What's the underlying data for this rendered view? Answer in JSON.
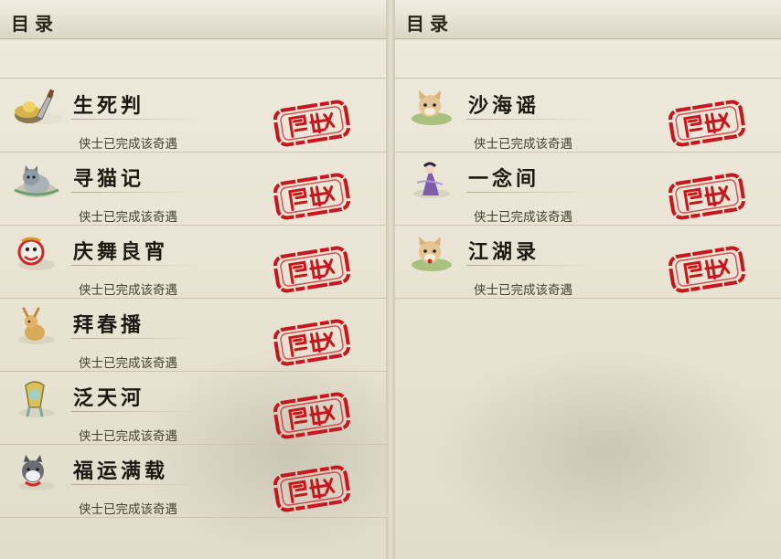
{
  "left_panel": {
    "title": "目录",
    "entries": [
      {
        "name": "生死判",
        "status": "侠士已完成该奇遇",
        "icon": "gold-ingot-knife-icon"
      },
      {
        "name": "寻猫记",
        "status": "侠士已完成该奇遇",
        "icon": "grey-cat-icon"
      },
      {
        "name": "庆舞良宵",
        "status": "侠士已完成该奇遇",
        "icon": "lion-dance-icon"
      },
      {
        "name": "拜春播",
        "status": "侠士已完成该奇遇",
        "icon": "deer-icon"
      },
      {
        "name": "泛天河",
        "status": "侠士已完成该奇遇",
        "icon": "jade-ornament-icon"
      },
      {
        "name": "福运满载",
        "status": "侠士已完成该奇遇",
        "icon": "husky-dog-icon"
      }
    ]
  },
  "right_panel": {
    "title": "目录",
    "entries": [
      {
        "name": "沙海谣",
        "status": "侠士已完成该奇遇",
        "icon": "fox-icon"
      },
      {
        "name": "一念间",
        "status": "侠士已完成该奇遇",
        "icon": "purple-figure-icon"
      },
      {
        "name": "江湖录",
        "status": "侠士已完成该奇遇",
        "icon": "fox-icon"
      }
    ]
  },
  "colors": {
    "stamp_red": "#c8161d",
    "background": "#e7e2d3"
  }
}
